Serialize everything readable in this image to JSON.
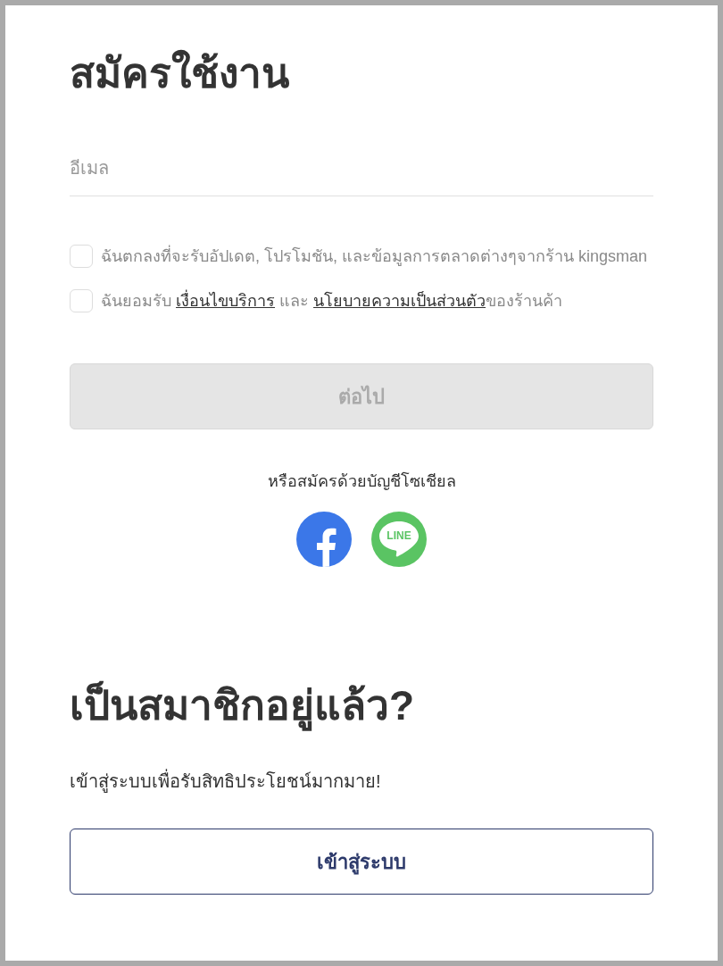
{
  "signup": {
    "title": "สมัครใช้งาน",
    "email_field": {
      "placeholder": "อีเมล"
    },
    "consents": [
      {
        "checked": false,
        "parts": [
          {
            "kind": "text",
            "text": "ฉันตกลงที่จะรับอัปเดต, โปรโมชัน, และข้อมูลการตลาดต่างๆจากร้าน kingsman"
          }
        ]
      },
      {
        "checked": false,
        "parts": [
          {
            "kind": "text",
            "text": "ฉันยอมรับ "
          },
          {
            "kind": "link",
            "text": "เงื่อนไขบริการ"
          },
          {
            "kind": "text",
            "text": " และ "
          },
          {
            "kind": "link",
            "text": "นโยบายความเป็นส่วนตัว"
          },
          {
            "kind": "text",
            "text": "ของร้านค้า"
          }
        ]
      }
    ],
    "continue_button": {
      "label": "ต่อไป",
      "disabled": true
    },
    "social_prompt": "หรือสมัครด้วยบัญชีโซเชียล",
    "social_buttons": [
      {
        "kind": "facebook"
      },
      {
        "kind": "line",
        "label": "LINE"
      }
    ]
  },
  "login": {
    "title": "เป็นสมาชิกอยู่แล้ว?",
    "subtitle": "เข้าสู่ระบบเพื่อรับสิทธิประโยชน์มากมาย!",
    "button": {
      "label": "เข้าสู่ระบบ"
    }
  }
}
